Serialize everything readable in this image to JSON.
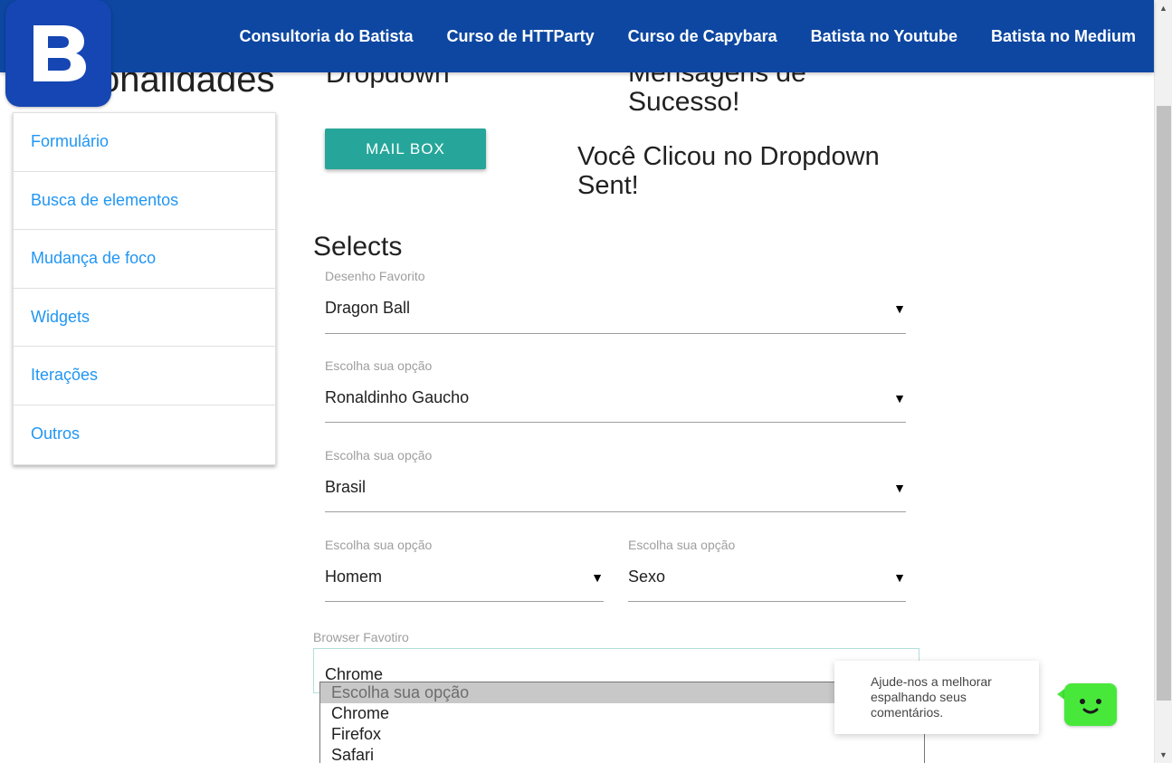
{
  "header": {
    "nav_links": [
      "Consultoria do Batista",
      "Curso de HTTParty",
      "Curso de Capybara",
      "Batista no Youtube",
      "Batista no Medium"
    ],
    "logo_letter": "B",
    "brand_color": "#0d47a1"
  },
  "page": {
    "title_partial": "onalidades",
    "dropdown_heading_partial": "Dropdown",
    "success_heading_line1": "Mensagens de",
    "success_heading_line2": "Sucesso!"
  },
  "sidebar": {
    "items": [
      "Formulário",
      "Busca de elementos",
      "Mudança de foco",
      "Widgets",
      "Iterações",
      "Outros"
    ]
  },
  "main": {
    "mail_button": "MAIL BOX",
    "clicked_message_line1": "Você Clicou no Dropdown",
    "clicked_message_line2": "Sent!",
    "selects_title": "Selects",
    "selects": [
      {
        "label": "Desenho Favorito",
        "value": "Dragon Ball"
      },
      {
        "label": "Escolha sua opção",
        "value": "Ronaldinho Gaucho"
      },
      {
        "label": "Escolha sua opção",
        "value": "Brasil"
      },
      {
        "label": "Escolha sua opção",
        "value": "Homem"
      },
      {
        "label": "Escolha sua opção",
        "value": "Sexo"
      }
    ],
    "caret": "▼",
    "browser": {
      "label": "Browser Favotiro",
      "value": "Chrome",
      "options": [
        "Escolha sua opção",
        "Chrome",
        "Firefox",
        "Safari"
      ],
      "highlighted_index": 0
    }
  },
  "chat": {
    "line1": "Ajude-nos a melhorar",
    "line2": "espalhando seus",
    "line3": "comentários."
  },
  "scrollbar": {
    "up_arrow": "▲",
    "down_arrow": "▼"
  }
}
